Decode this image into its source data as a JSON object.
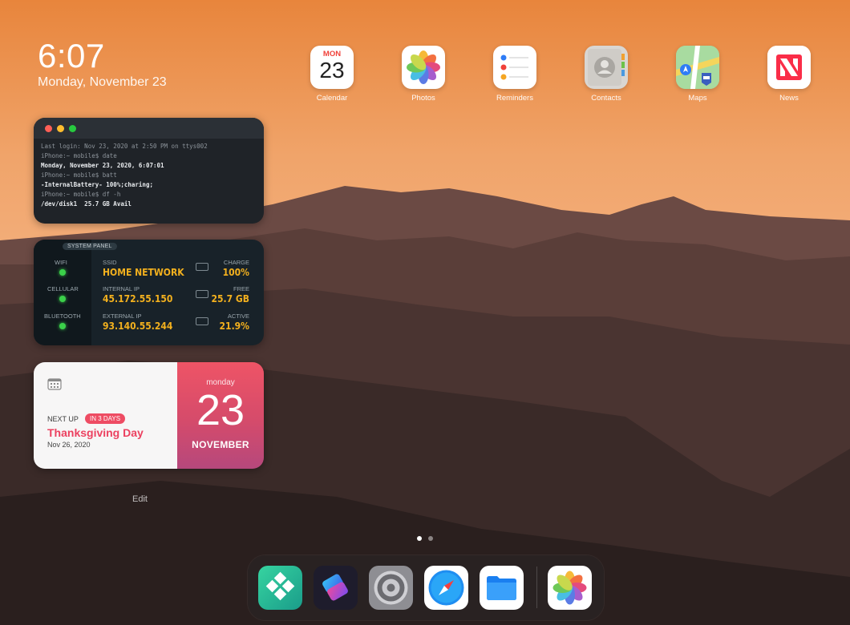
{
  "status": {
    "time": "6:07",
    "date": "Monday, November 23"
  },
  "apps": [
    {
      "label": "Calendar",
      "icon": "calendar-icon",
      "month": "MON",
      "day": "23"
    },
    {
      "label": "Photos",
      "icon": "photos-icon"
    },
    {
      "label": "Reminders",
      "icon": "reminders-icon"
    },
    {
      "label": "Contacts",
      "icon": "contacts-icon"
    },
    {
      "label": "Maps",
      "icon": "maps-icon"
    },
    {
      "label": "News",
      "icon": "news-icon"
    }
  ],
  "terminal": {
    "lines": [
      "Last login: Nov 23, 2020 at 2:50 PM on ttys002",
      "iPhone:~ mobile$ date",
      "Monday, November 23, 2020, 6:07:01",
      "iPhone:~ mobile$ batt",
      "-InternalBattery- 100%;charing;",
      "iPhone:~ mobile$ df -h",
      "/dev/disk1  25.7 GB Avail"
    ]
  },
  "system_panel": {
    "tag": "SYSTEM PANEL",
    "wifi_label": "WIFI",
    "cellular_label": "CELLULAR",
    "bluetooth_label": "BLUETOOTH",
    "ssid_label": "SSID",
    "ssid_value": "HOME NETWORK",
    "internal_ip_label": "INTERNAL IP",
    "internal_ip_value": "45.172.55.150",
    "external_ip_label": "EXTERNAL IP",
    "external_ip_value": "93.140.55.244",
    "charge_label": "CHARGE",
    "charge_value": "100%",
    "free_label": "FREE",
    "free_value": "25.7 GB",
    "active_label": "ACTIVE",
    "active_value": "21.9%"
  },
  "calendar_widget": {
    "next_up": "NEXT UP",
    "badge": "IN 3 DAYS",
    "event": "Thanksgiving Day",
    "event_date": "Nov 26, 2020",
    "weekday": "monday",
    "day": "23",
    "month": "NOVEMBER"
  },
  "edit_label": "Edit",
  "dock": [
    "shortcuts-alt-icon",
    "shortcuts-icon",
    "settings-icon",
    "safari-icon",
    "files-icon",
    "photos-icon"
  ],
  "colors": {
    "accent_red": "#ec4160",
    "led_green": "#3bd14a",
    "panel_value": "#f2b01e"
  }
}
